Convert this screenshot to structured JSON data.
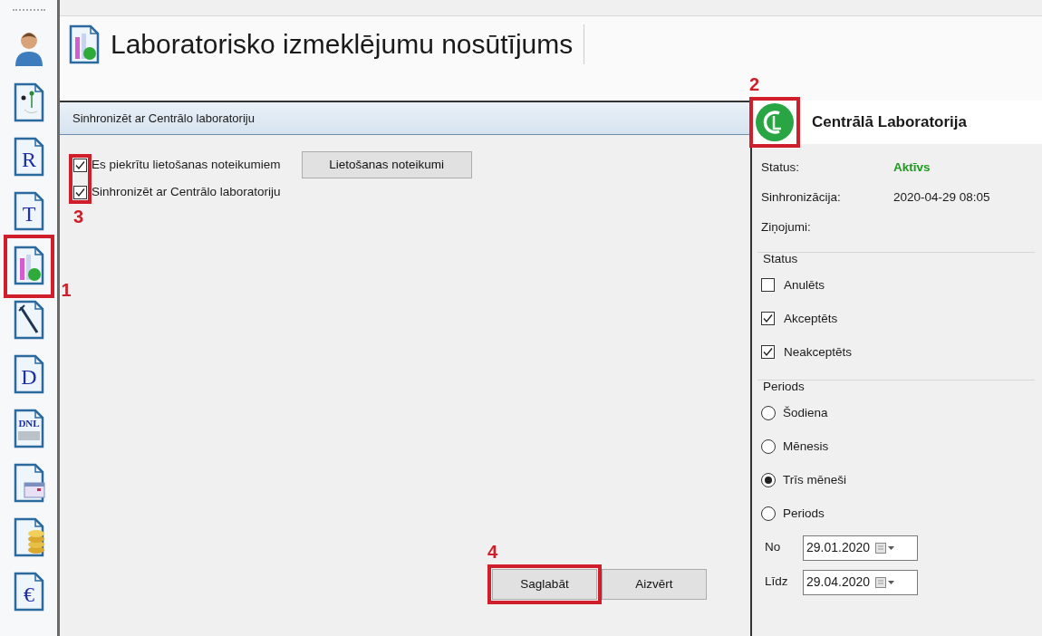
{
  "sidebar": {
    "items": [
      {
        "kind": "person"
      },
      {
        "kind": "plant"
      },
      {
        "kind": "letter",
        "glyph": "R"
      },
      {
        "kind": "letter",
        "glyph": "T"
      },
      {
        "kind": "lab"
      },
      {
        "kind": "syringe"
      },
      {
        "kind": "letter",
        "glyph": "D"
      },
      {
        "kind": "banner",
        "glyph": "DNL"
      },
      {
        "kind": "calendar"
      },
      {
        "kind": "coins"
      },
      {
        "kind": "letter",
        "glyph": "€"
      }
    ]
  },
  "title": "Laboratorisko izmeklējumu nosūtījums",
  "sync_panel": {
    "header": "Sinhronizēt ar Centrālo laboratoriju",
    "options": [
      {
        "label": "Es piekrītu lietošanas noteikumiem",
        "checked": true
      },
      {
        "label": "Sinhronizēt ar Centrālo laboratoriju",
        "checked": true
      }
    ],
    "terms_button": "Lietošanas noteikumi",
    "buttons": [
      "Saglabāt",
      "Aizvērt"
    ]
  },
  "lab_panel": {
    "title": "Centrālā Laboratorija",
    "info": [
      {
        "label": "Status:",
        "value": "Aktīvs",
        "kind": "status"
      },
      {
        "label": "Sinhronizācija:",
        "value": "2020-04-29 08:05",
        "kind": "plain"
      },
      {
        "label": "Ziņojumi:",
        "kind": "plain"
      }
    ],
    "status_group": {
      "legend": "Status",
      "options": [
        {
          "label": "Anulēts",
          "checked": false
        },
        {
          "label": "Akceptēts",
          "checked": true
        },
        {
          "label": "Neakceptēts",
          "checked": true
        }
      ]
    },
    "period_group": {
      "legend": "Periods",
      "options": [
        {
          "label": "Šodiena",
          "selected": false
        },
        {
          "label": "Mēnesis",
          "selected": false
        },
        {
          "label": "Trīs mēneši",
          "selected": true
        },
        {
          "label": "Periods",
          "selected": false
        }
      ],
      "dates": [
        {
          "label": "No",
          "value": "29.01.2020"
        },
        {
          "label": "Līdz",
          "value": "29.04.2020"
        }
      ]
    }
  },
  "annotations": [
    {
      "label": "1",
      "kind": "sidebar_item"
    },
    {
      "label": "2",
      "kind": "logo"
    },
    {
      "label": "3",
      "kind": "checkboxes"
    },
    {
      "label": "4",
      "kind": "save_button"
    }
  ]
}
